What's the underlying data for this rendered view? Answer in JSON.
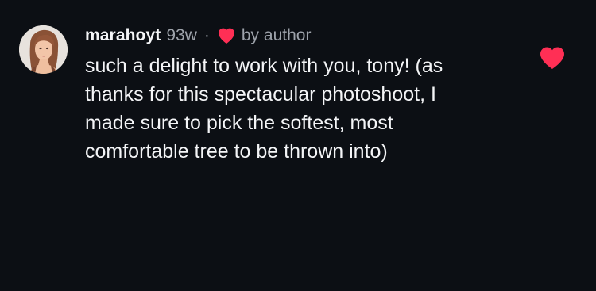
{
  "comment": {
    "username": "marahoyt",
    "age": "93w",
    "separator": "·",
    "author_liked_label": "by author",
    "text_lines": [
      "such a delight to work with you, tony! (as",
      "thanks for this spectacular photoshoot, I",
      "made sure to pick the softest, most",
      "comfortable tree to be thrown into)"
    ],
    "liked": true
  },
  "icons": {
    "author_like": "heart-icon",
    "like": "heart-icon"
  },
  "colors": {
    "background": "#0c0f14",
    "primary_text": "#f4f5f7",
    "secondary_text": "#9ea3ab",
    "heart": "#ff2f55"
  }
}
